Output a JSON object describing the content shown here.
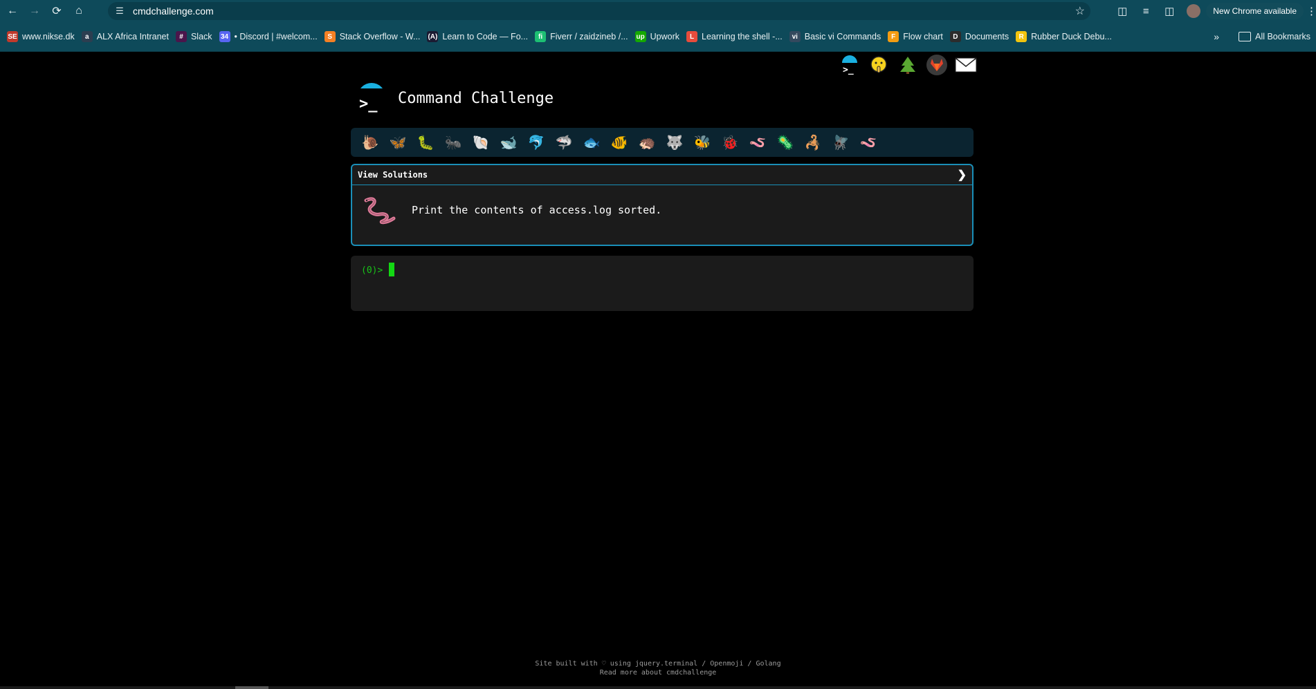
{
  "browser": {
    "url": "cmdchallenge.com",
    "update_label": "New Chrome available",
    "bookmarks": [
      {
        "label": "www.nikse.dk",
        "color": "#c0392b",
        "glyph": "SE"
      },
      {
        "label": "ALX Africa Intranet",
        "color": "#2c3e50",
        "glyph": "a"
      },
      {
        "label": "Slack",
        "color": "#4a154b",
        "glyph": "#"
      },
      {
        "label": "• Discord | #welcom...",
        "color": "#5865f2",
        "glyph": "34"
      },
      {
        "label": "Stack Overflow - W...",
        "color": "#f48024",
        "glyph": "S"
      },
      {
        "label": "Learn to Code — Fo...",
        "color": "#1b1b32",
        "glyph": "(A)"
      },
      {
        "label": "Fiverr / zaidzineb /...",
        "color": "#1dbf73",
        "glyph": "fi"
      },
      {
        "label": "Upwork",
        "color": "#14a800",
        "glyph": "up"
      },
      {
        "label": "Learning the shell -...",
        "color": "#e74c3c",
        "glyph": "L"
      },
      {
        "label": "Basic vi Commands",
        "color": "#34495e",
        "glyph": "vi"
      },
      {
        "label": "Flow chart",
        "color": "#f39c12",
        "glyph": "F"
      },
      {
        "label": "Documents",
        "color": "#2c2c2c",
        "glyph": "D"
      },
      {
        "label": "Rubber Duck Debu...",
        "color": "#f1c40f",
        "glyph": "R"
      }
    ],
    "all_bookmarks_label": "All Bookmarks"
  },
  "page": {
    "title": "Command Challenge",
    "view_solutions_label": "View Solutions",
    "task_text": "Print the contents of access.log sorted.",
    "prompt": "(0)>",
    "footer_line1": "Site built with ♡ using jquery.terminal / Openmoji / Golang",
    "footer_line2": "Read more about cmdchallenge",
    "social_icons": [
      "terminal-icon",
      "emoji-shh-icon",
      "tree-icon",
      "gitlab-icon",
      "mail-icon"
    ],
    "level_icons": [
      "snail",
      "butterfly",
      "caterpillar",
      "ant",
      "spiral-shell",
      "whale",
      "dolphin",
      "shark",
      "fish",
      "tropical-fish",
      "hedgehog",
      "wolf",
      "bee",
      "ladybug",
      "worm",
      "tadpole",
      "scorpion",
      "fly",
      "earthworm"
    ]
  }
}
